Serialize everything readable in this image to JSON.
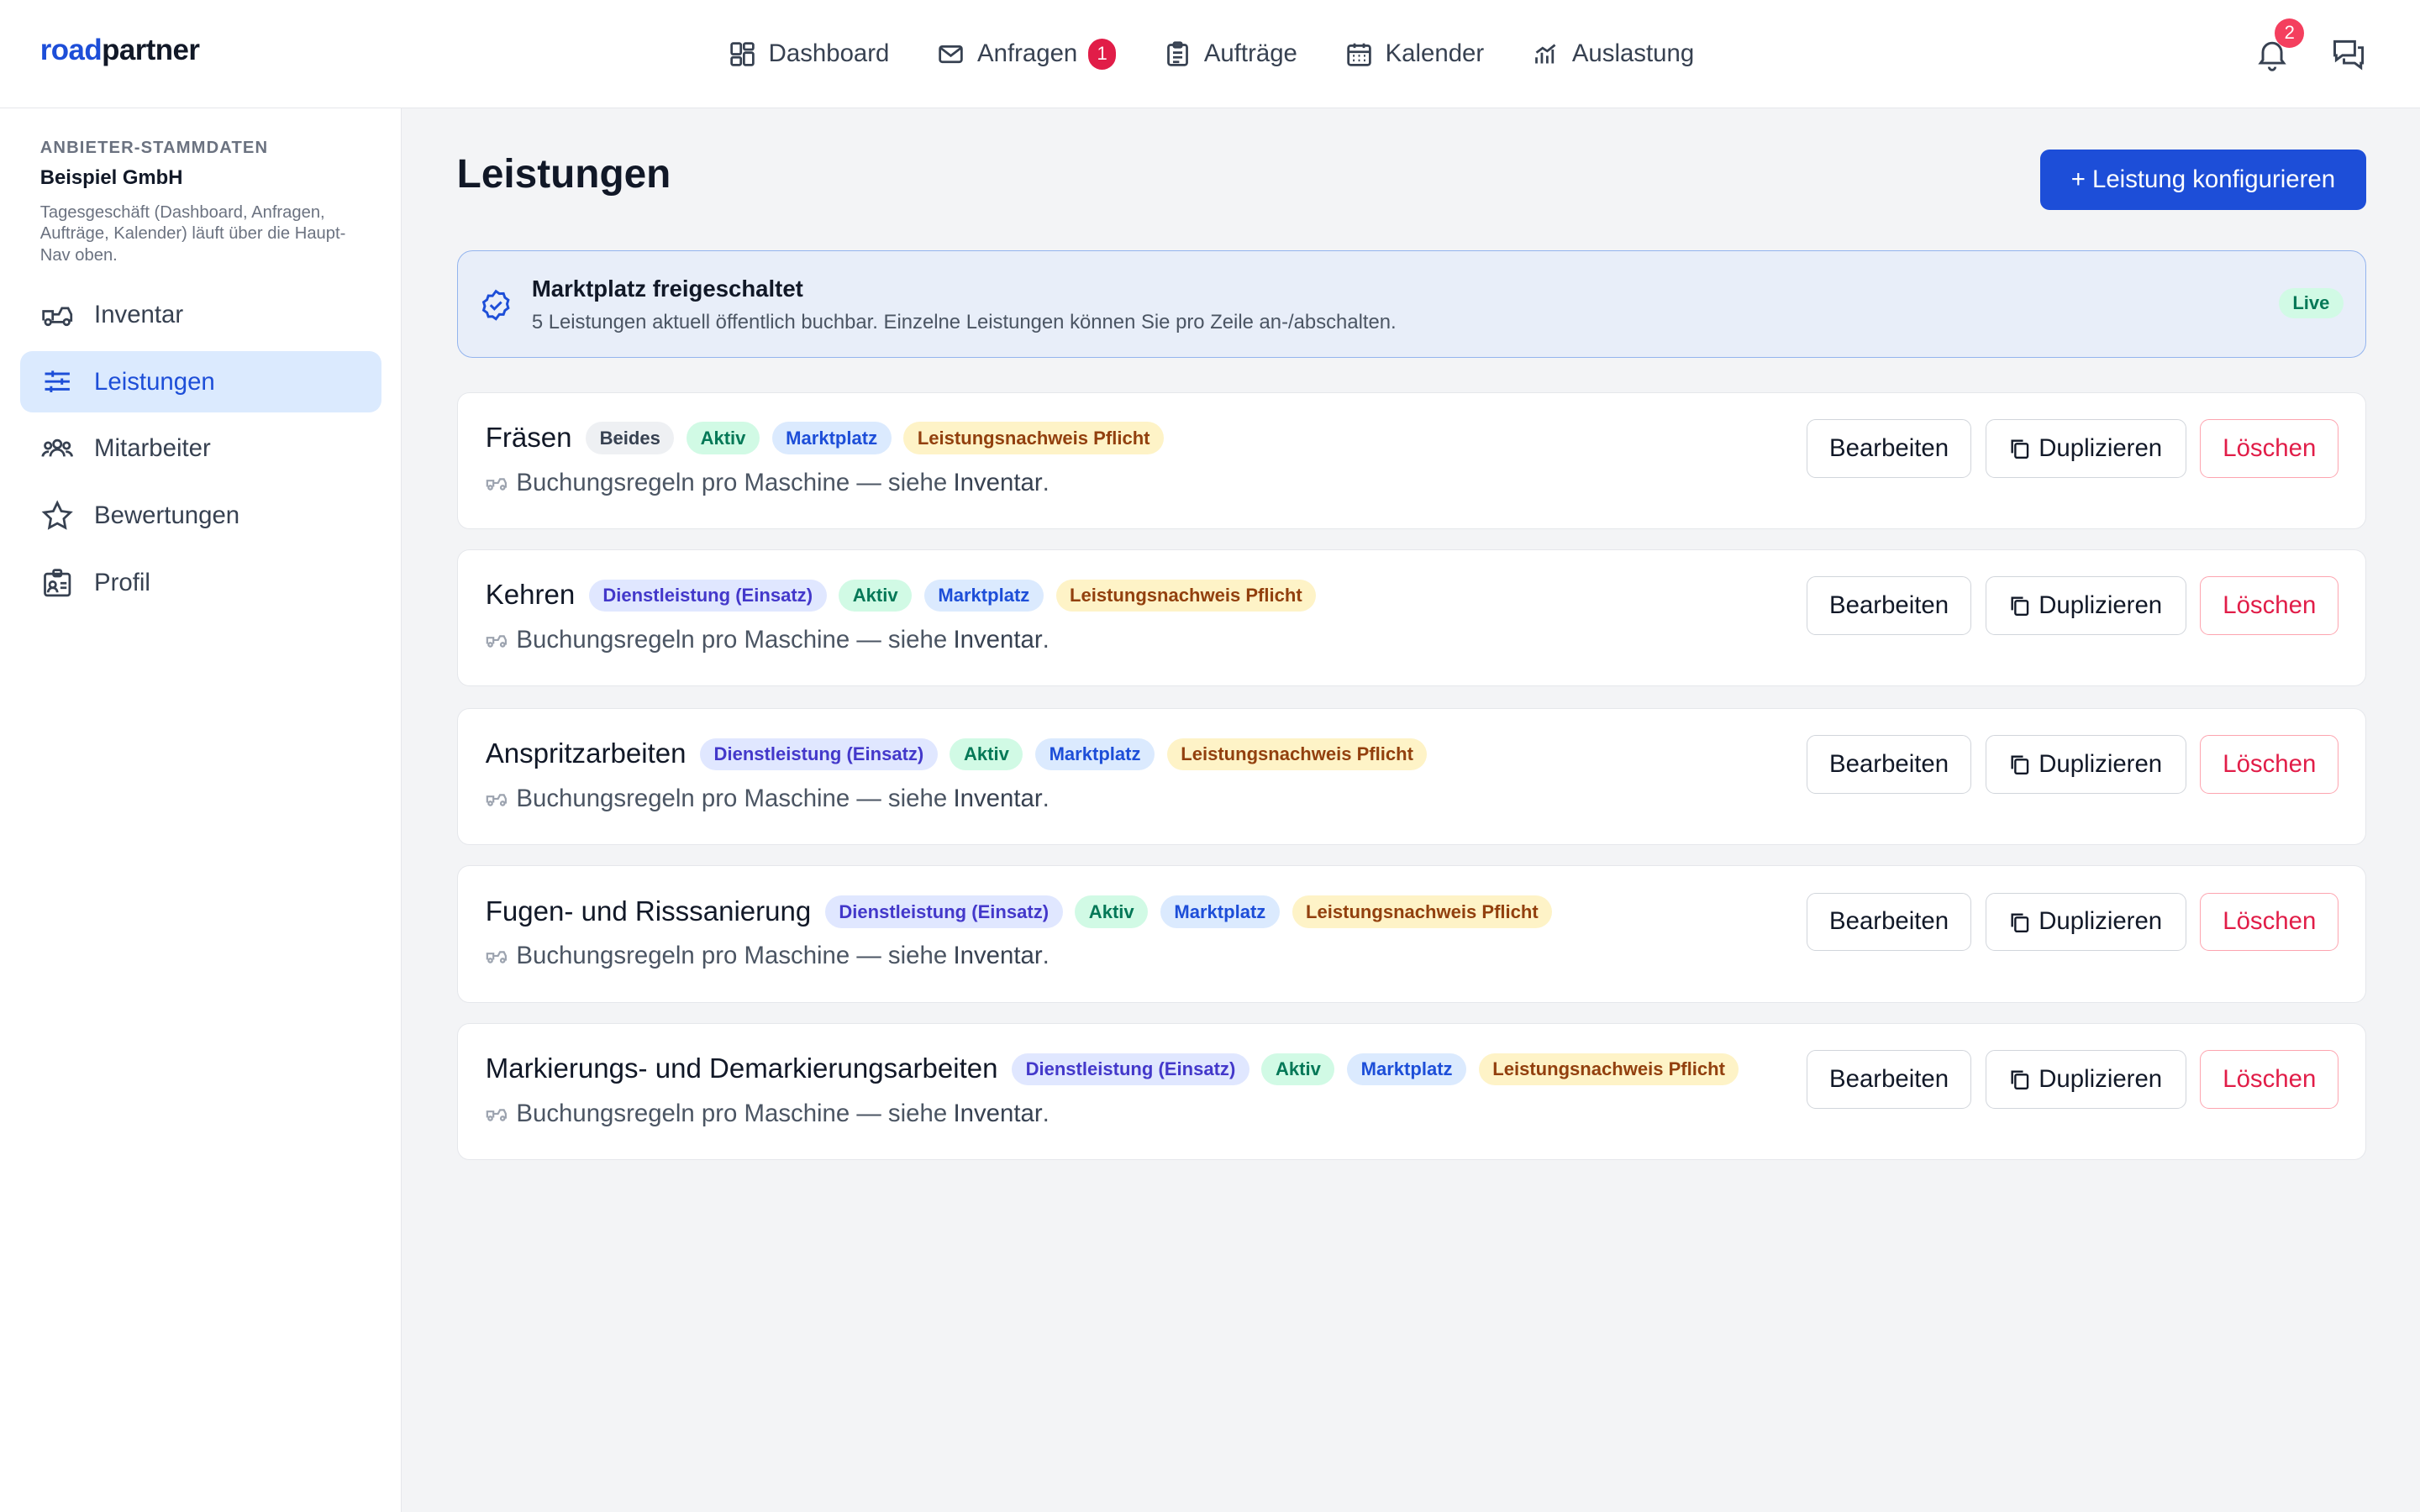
{
  "app": {
    "logo_part1": "road",
    "logo_part2": "partner"
  },
  "nav": [
    {
      "label": "Dashboard",
      "icon": "dashboard-icon"
    },
    {
      "label": "Anfragen",
      "icon": "mail-icon",
      "badge": "1"
    },
    {
      "label": "Aufträge",
      "icon": "clipboard-icon"
    },
    {
      "label": "Kalender",
      "icon": "calendar-icon"
    },
    {
      "label": "Auslastung",
      "icon": "chart-icon"
    }
  ],
  "header": {
    "notifications_count": "2"
  },
  "sidebar": {
    "eyebrow": "ANBIETER-STAMMDATEN",
    "company": "Beispiel GmbH",
    "hint": "Tagesgeschäft (Dashboard, Anfragen, Aufträge, Kalender) läuft über die Haupt-Nav oben.",
    "items": [
      {
        "label": "Inventar",
        "icon": "truck-icon"
      },
      {
        "label": "Leistungen",
        "icon": "sliders-icon",
        "active": true
      },
      {
        "label": "Mitarbeiter",
        "icon": "team-icon"
      },
      {
        "label": "Bewertungen",
        "icon": "star-icon"
      },
      {
        "label": "Profil",
        "icon": "profile-icon"
      }
    ]
  },
  "main": {
    "title": "Leistungen",
    "primary_button": "+ Leistung konfigurieren",
    "banner": {
      "title": "Marktplatz freigeschaltet",
      "text": "5 Leistungen aktuell öffentlich buchbar. Einzelne Leistungen können Sie pro Zeile an-/abschalten.",
      "badge": "Live"
    },
    "services": [
      {
        "name": "Fräsen",
        "tags": [
          {
            "label": "Beides",
            "color": "gray"
          },
          {
            "label": "Aktiv",
            "color": "green"
          },
          {
            "label": "Marktplatz",
            "color": "blue"
          },
          {
            "label": "Leistungsnachweis Pflicht",
            "color": "amber"
          }
        ],
        "sub": "Buchungsregeln pro Maschine — siehe",
        "link": "Inventar",
        "suffix": "."
      },
      {
        "name": "Kehren",
        "tags": [
          {
            "label": "Dienstleistung (Einsatz)",
            "color": "purple"
          },
          {
            "label": "Aktiv",
            "color": "green"
          },
          {
            "label": "Marktplatz",
            "color": "blue"
          },
          {
            "label": "Leistungsnachweis Pflicht",
            "color": "amber"
          }
        ],
        "sub": "Buchungsregeln pro Maschine — siehe",
        "link": "Inventar",
        "suffix": "."
      },
      {
        "name": "Anspritzarbeiten",
        "tags": [
          {
            "label": "Dienstleistung (Einsatz)",
            "color": "purple"
          },
          {
            "label": "Aktiv",
            "color": "green"
          },
          {
            "label": "Marktplatz",
            "color": "blue"
          },
          {
            "label": "Leistungsnachweis Pflicht",
            "color": "amber"
          }
        ],
        "sub": "Buchungsregeln pro Maschine — siehe",
        "link": "Inventar",
        "suffix": "."
      },
      {
        "name": "Fugen- und Risssanierung",
        "tags": [
          {
            "label": "Dienstleistung (Einsatz)",
            "color": "purple"
          },
          {
            "label": "Aktiv",
            "color": "green"
          },
          {
            "label": "Marktplatz",
            "color": "blue"
          },
          {
            "label": "Leistungsnachweis Pflicht",
            "color": "amber"
          }
        ],
        "sub": "Buchungsregeln pro Maschine — siehe",
        "link": "Inventar",
        "suffix": "."
      },
      {
        "name": "Markierungs- und Demarkierungsarbeiten",
        "tags": [
          {
            "label": "Dienstleistung (Einsatz)",
            "color": "purple"
          },
          {
            "label": "Aktiv",
            "color": "green"
          },
          {
            "label": "Marktplatz",
            "color": "blue"
          },
          {
            "label": "Leistungsnachweis Pflicht",
            "color": "amber"
          }
        ],
        "sub": "Buchungsregeln pro Maschine — siehe",
        "link": "Inventar",
        "suffix": "."
      }
    ],
    "actions": {
      "edit": "Bearbeiten",
      "duplicate": "Duplizieren",
      "delete": "Löschen"
    }
  },
  "colors": {
    "accent": "#1d4ed8",
    "danger": "#e11d48",
    "background": "#f3f4f6"
  }
}
